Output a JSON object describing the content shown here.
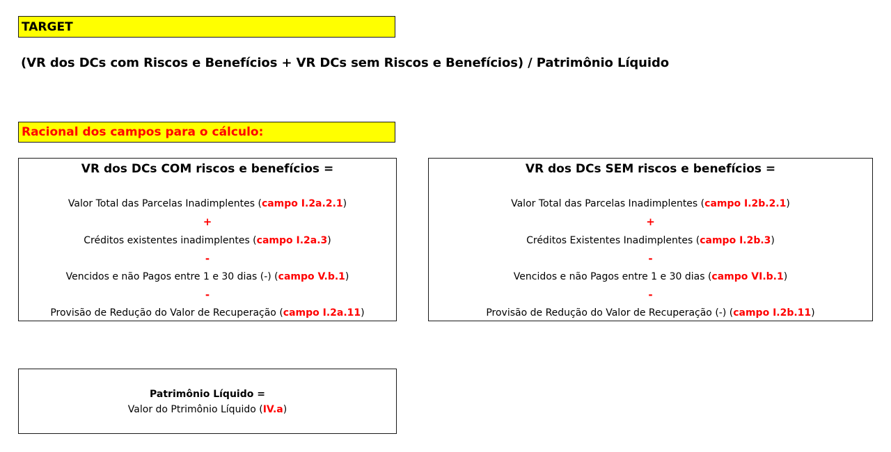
{
  "target_label": "TARGET",
  "formula": "(VR dos DCs com Riscos e Benefícios + VR DCs sem Riscos e Benefícios) / Patrimônio Líquido",
  "racional_label": "Racional dos campos para o cálculo:",
  "com_panel": {
    "title": "VR dos DCs COM riscos e benefícios =",
    "rows": [
      {
        "text": "Valor Total das Parcelas Inadimplentes (",
        "ref": "campo I.2a.2.1",
        "close": ")"
      },
      {
        "text": "Créditos existentes inadimplentes (",
        "ref": "campo I.2a.3",
        "close": ")"
      },
      {
        "text": "Vencidos e não Pagos entre 1 e 30 dias (-) (",
        "ref": "campo V.b.1",
        "close": ")"
      },
      {
        "text": "Provisão de Redução do Valor de Recuperação  (",
        "ref": "campo I.2a.11",
        "close": ")"
      }
    ],
    "ops": [
      "+",
      "-",
      "-"
    ]
  },
  "sem_panel": {
    "title": "VR dos DCs SEM riscos e benefícios =",
    "rows": [
      {
        "text": "Valor Total das Parcelas Inadimplentes (",
        "ref": "campo I.2b.2.1",
        "close": ")"
      },
      {
        "text": "Créditos Existentes Inadimplentes (",
        "ref": "campo I.2b.3",
        "close": ")"
      },
      {
        "text": "Vencidos e não Pagos entre 1 e 30 dias (",
        "ref": "campo VI.b.1",
        "close": ")"
      },
      {
        "text": "Provisão de Redução do Valor de Recuperação (-) (",
        "ref": "campo I.2b.11",
        "close": ")"
      }
    ],
    "ops": [
      "+",
      "-",
      "-"
    ]
  },
  "pl_panel": {
    "title": "Patrimônio Líquido =",
    "text": "Valor do Ptrimônio Líquido (",
    "ref": "IV.a",
    "close": ")"
  },
  "colors": {
    "highlight": "#ffff00",
    "reference_red": "#ff0000"
  }
}
